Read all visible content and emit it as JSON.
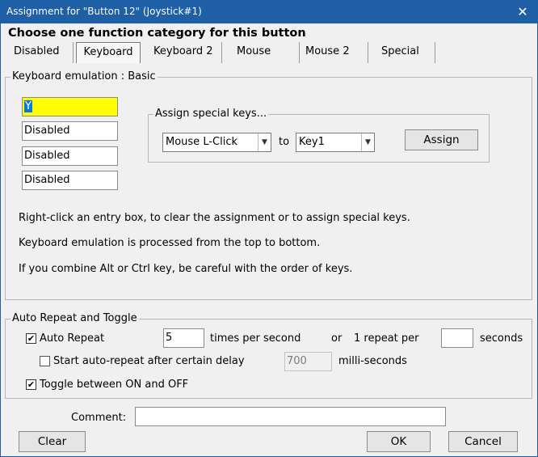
{
  "window": {
    "title": "Assignment for \"Button 12\" (Joystick#1)",
    "close_glyph": "✕"
  },
  "heading": "Choose one function category for this button",
  "tabs": [
    "Disabled",
    "Keyboard",
    "Keyboard 2",
    "Mouse",
    "Mouse 2",
    "Special"
  ],
  "active_tab": "Keyboard",
  "keyboard": {
    "group_label": "Keyboard emulation : Basic",
    "entries": [
      "Y",
      "Disabled",
      "Disabled",
      "Disabled"
    ],
    "special": {
      "label": "Assign special keys...",
      "from_value": "Mouse L-Click",
      "to_label": "to",
      "to_value": "Key1",
      "assign_label": "Assign"
    },
    "info": [
      "Right-click an entry box, to clear the assignment or to assign special keys.",
      "Keyboard emulation is processed from the top to bottom.",
      "If you combine Alt or Ctrl key, be careful with the order of keys."
    ]
  },
  "auto_repeat": {
    "group_label": "Auto Repeat and Toggle",
    "auto_repeat_label": "Auto Repeat",
    "auto_repeat_checked": true,
    "times_value": "5",
    "times_label": "times per second",
    "or_label": "or",
    "one_repeat_label": "1 repeat per",
    "seconds_value": "",
    "seconds_label": "seconds",
    "delay_label": "Start auto-repeat after certain delay",
    "delay_checked": false,
    "delay_value": "700",
    "delay_unit": "milli-seconds",
    "toggle_label": "Toggle between ON and OFF",
    "toggle_checked": true
  },
  "comment": {
    "label": "Comment:",
    "value": ""
  },
  "buttons": {
    "clear": "Clear",
    "ok": "OK",
    "cancel": "Cancel"
  },
  "colors": {
    "titlebar": "#1f5fa6",
    "active_entry": "#ffff00",
    "selection": "#0b78d7"
  }
}
